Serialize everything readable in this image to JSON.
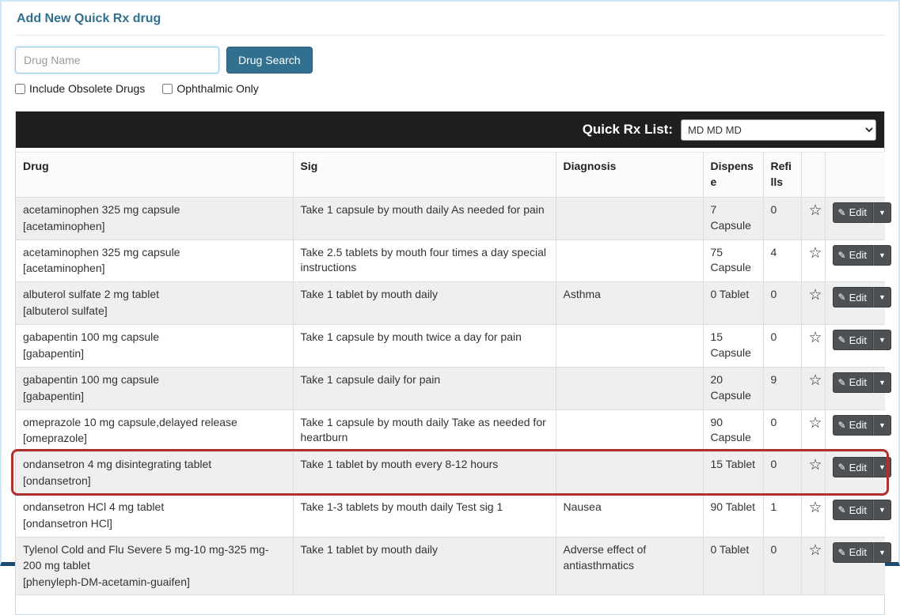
{
  "page": {
    "title": "Add New Quick Rx drug"
  },
  "colors": {
    "accent": "#31708f",
    "header_bar": "#1f1f1f",
    "highlight_border": "#b02f2f",
    "edit_button": "#4d5154",
    "page_border": "#cfe7f6",
    "bottom_border": "#1b4a72",
    "row_alt": "#efefef"
  },
  "icons": {
    "favorite_star": "☆",
    "edit_pencil": "✎",
    "caret_down": "▼"
  },
  "search": {
    "placeholder": "Drug Name",
    "button_label": "Drug Search",
    "checkboxes": [
      {
        "label": "Include Obsolete Drugs",
        "checked": false
      },
      {
        "label": "Ophthalmic Only",
        "checked": false
      }
    ]
  },
  "quick_rx_list": {
    "label": "Quick Rx List:",
    "selected": "MD MD MD"
  },
  "table": {
    "headers": [
      "Drug",
      "Sig",
      "Diagnosis",
      "Dispense",
      "Refills"
    ],
    "edit_label": "Edit",
    "rows": [
      {
        "drug": "acetaminophen 325 mg capsule",
        "generic": "[acetaminophen]",
        "sig": "Take 1 capsule by mouth daily As needed for pain",
        "diagnosis": "",
        "dispense": "7 Capsule",
        "refills": "0",
        "highlighted": false
      },
      {
        "drug": "acetaminophen 325 mg capsule",
        "generic": "[acetaminophen]",
        "sig": "Take 2.5 tablets by mouth four times a day special instructions",
        "diagnosis": "",
        "dispense": "75 Capsule",
        "refills": "4",
        "highlighted": false
      },
      {
        "drug": "albuterol sulfate 2 mg tablet",
        "generic": "[albuterol sulfate]",
        "sig": "Take 1 tablet by mouth daily",
        "diagnosis": "Asthma",
        "dispense": "0 Tablet",
        "refills": "0",
        "highlighted": false
      },
      {
        "drug": "gabapentin 100 mg capsule",
        "generic": "[gabapentin]",
        "sig": "Take 1 capsule by mouth twice a day for pain",
        "diagnosis": "",
        "dispense": "15 Capsule",
        "refills": "0",
        "highlighted": false
      },
      {
        "drug": "gabapentin 100 mg capsule",
        "generic": "[gabapentin]",
        "sig": "Take 1 capsule daily for pain",
        "diagnosis": "",
        "dispense": "20 Capsule",
        "refills": "9",
        "highlighted": false
      },
      {
        "drug": "omeprazole 10 mg capsule,delayed release",
        "generic": "[omeprazole]",
        "sig": "Take 1 capsule by mouth daily Take as needed for heartburn",
        "diagnosis": "",
        "dispense": "90 Capsule",
        "refills": "0",
        "highlighted": false
      },
      {
        "drug": "ondansetron 4 mg disintegrating tablet",
        "generic": "[ondansetron]",
        "sig": "Take 1 tablet by mouth every 8-12 hours",
        "diagnosis": "",
        "dispense": "15 Tablet",
        "refills": "0",
        "highlighted": true
      },
      {
        "drug": "ondansetron HCl 4 mg tablet",
        "generic": "[ondansetron HCl]",
        "sig": "Take 1-3 tablets by mouth daily Test sig 1",
        "diagnosis": "Nausea",
        "dispense": "90 Tablet",
        "refills": "1",
        "highlighted": false
      },
      {
        "drug": "Tylenol Cold and Flu Severe 5 mg-10 mg-325 mg-200 mg tablet",
        "generic": "[phenyleph-DM-acetamin-guaifen]",
        "sig": "Take 1 tablet by mouth daily",
        "diagnosis": "Adverse effect of antiasthmatics",
        "dispense": "0 Tablet",
        "refills": "0",
        "highlighted": false
      }
    ]
  }
}
